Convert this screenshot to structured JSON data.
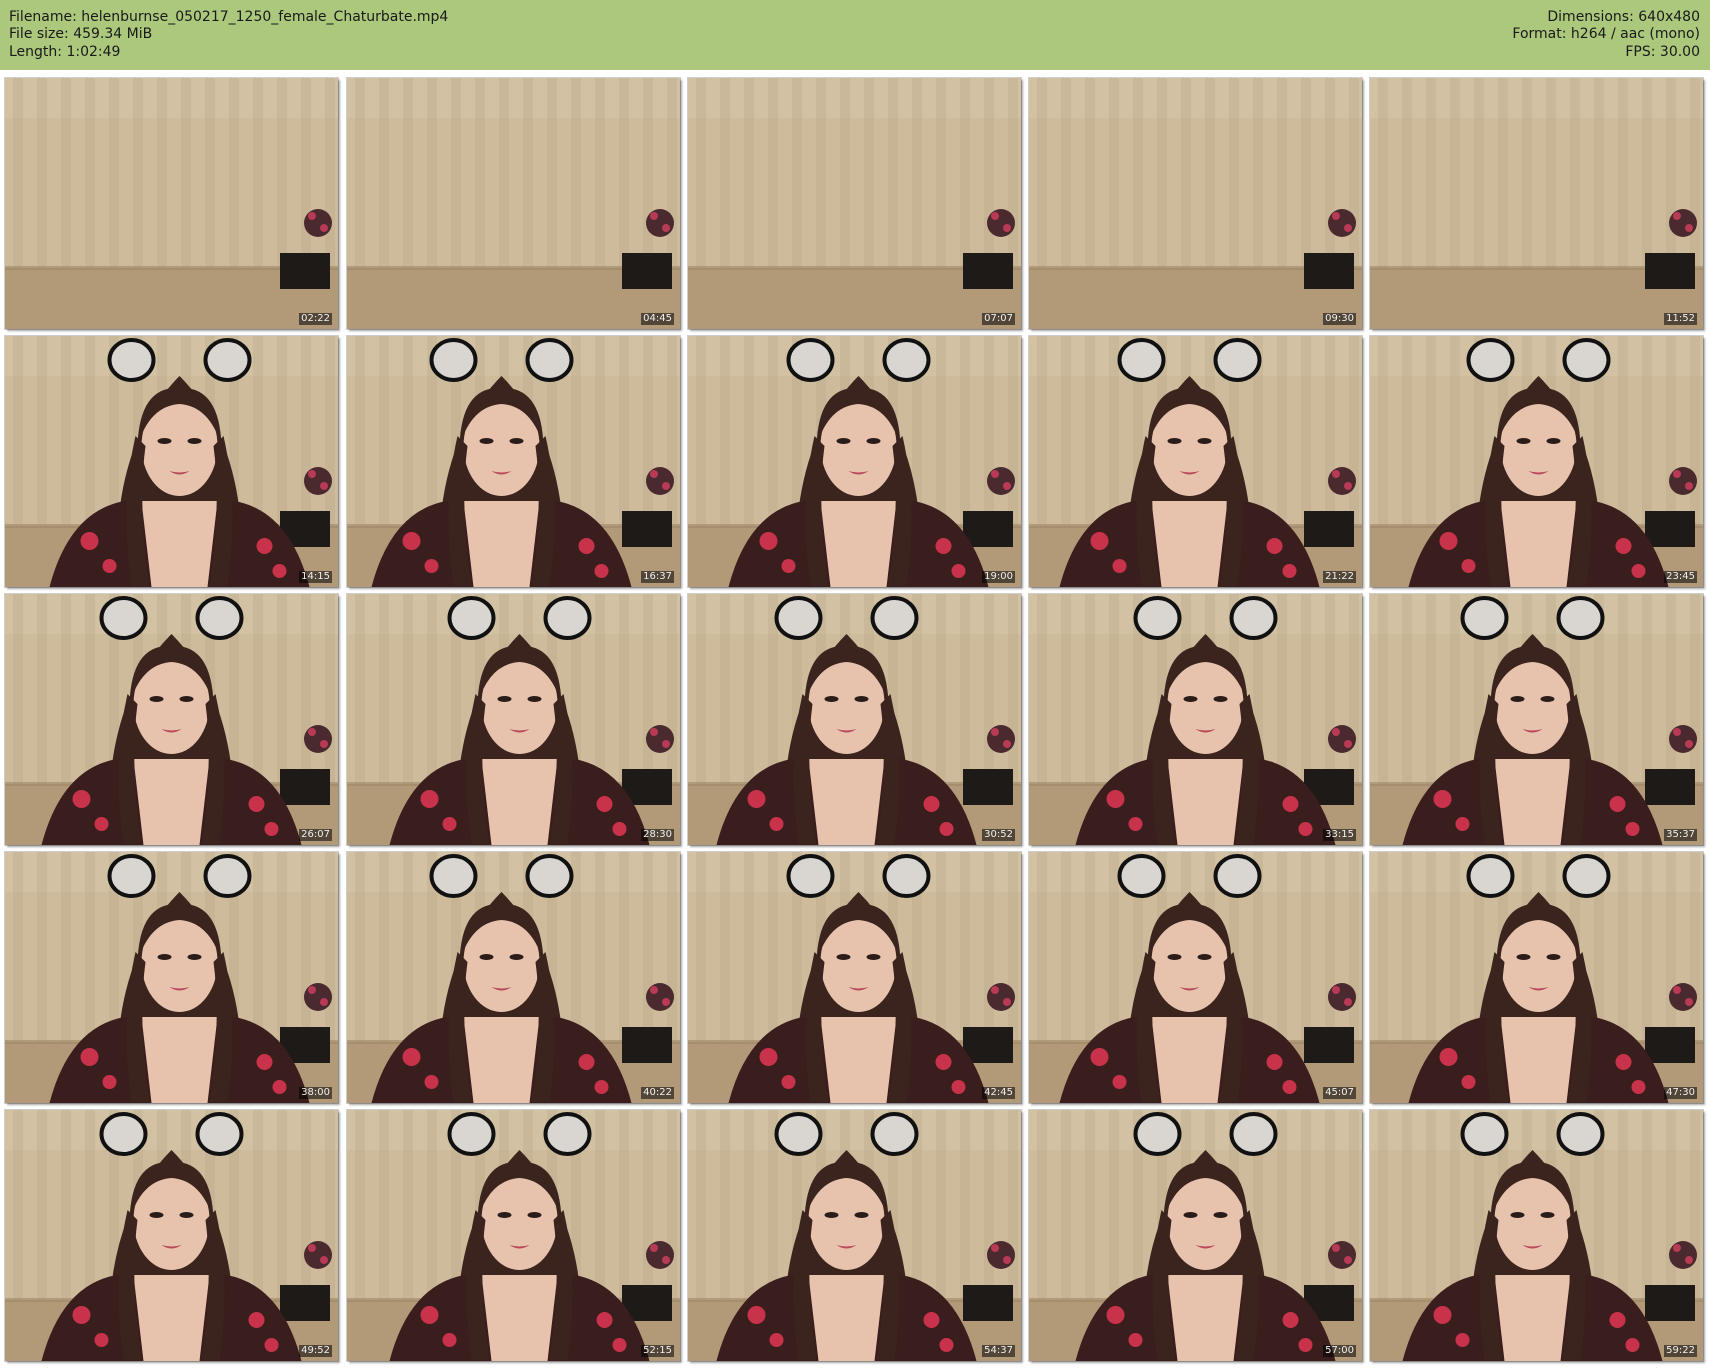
{
  "header": {
    "filename_line": "Filename: helenburnse_050217_1250_female_Chaturbate.mp4",
    "filesize_line": "File size: 459.34 MiB",
    "length_line": "Length: 1:02:49",
    "dimensions_line": "Dimensions: 640x480",
    "format_line": "Format: h264 / aac (mono)",
    "fps_line": "FPS: 30.00"
  },
  "colors": {
    "header_bg": "#abc87c",
    "curtain": "#cdbb9c",
    "floor": "#b29a78",
    "hair": "#3a241d",
    "skin": "#e7c2ad",
    "dress": "#3a1d1d",
    "rose": "#c8324a",
    "ear_fill": "#d9d6d2",
    "ear_outline": "#111111"
  },
  "thumbnails": [
    {
      "timestamp": "02:22",
      "person": false
    },
    {
      "timestamp": "04:45",
      "person": false
    },
    {
      "timestamp": "07:07",
      "person": false
    },
    {
      "timestamp": "09:30",
      "person": false
    },
    {
      "timestamp": "11:52",
      "person": false
    },
    {
      "timestamp": "14:15",
      "person": true
    },
    {
      "timestamp": "16:37",
      "person": true
    },
    {
      "timestamp": "19:00",
      "person": true
    },
    {
      "timestamp": "21:22",
      "person": true
    },
    {
      "timestamp": "23:45",
      "person": true
    },
    {
      "timestamp": "26:07",
      "person": true
    },
    {
      "timestamp": "28:30",
      "person": true
    },
    {
      "timestamp": "30:52",
      "person": true
    },
    {
      "timestamp": "33:15",
      "person": true
    },
    {
      "timestamp": "35:37",
      "person": true
    },
    {
      "timestamp": "38:00",
      "person": true
    },
    {
      "timestamp": "40:22",
      "person": true
    },
    {
      "timestamp": "42:45",
      "person": true
    },
    {
      "timestamp": "45:07",
      "person": true
    },
    {
      "timestamp": "47:30",
      "person": true
    },
    {
      "timestamp": "49:52",
      "person": true
    },
    {
      "timestamp": "52:15",
      "person": true
    },
    {
      "timestamp": "54:37",
      "person": true
    },
    {
      "timestamp": "57:00",
      "person": true
    },
    {
      "timestamp": "59:22",
      "person": true
    }
  ]
}
